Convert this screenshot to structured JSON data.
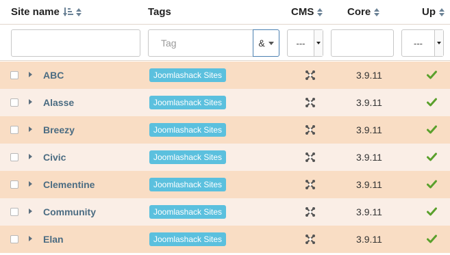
{
  "header": {
    "site_name": "Site name",
    "tags": "Tags",
    "cms": "CMS",
    "core": "Core",
    "up": "Up"
  },
  "filters": {
    "site_name_value": "",
    "tag_placeholder": "Tag",
    "tag_mode": "&",
    "cms_select": "---",
    "core_value": "",
    "up_select": "---"
  },
  "rows": [
    {
      "name": "ABC",
      "tag": "Joomlashack Sites",
      "cms_icon": "joomla-icon",
      "core": "3.9.11",
      "up_icon": "check-icon"
    },
    {
      "name": "Alasse",
      "tag": "Joomlashack Sites",
      "cms_icon": "joomla-icon",
      "core": "3.9.11",
      "up_icon": "check-icon"
    },
    {
      "name": "Breezy",
      "tag": "Joomlashack Sites",
      "cms_icon": "joomla-icon",
      "core": "3.9.11",
      "up_icon": "check-icon"
    },
    {
      "name": "Civic",
      "tag": "Joomlashack Sites",
      "cms_icon": "joomla-icon",
      "core": "3.9.11",
      "up_icon": "check-icon"
    },
    {
      "name": "Clementine",
      "tag": "Joomlashack Sites",
      "cms_icon": "joomla-icon",
      "core": "3.9.11",
      "up_icon": "check-icon"
    },
    {
      "name": "Community",
      "tag": "Joomlashack Sites",
      "cms_icon": "joomla-icon",
      "core": "3.9.11",
      "up_icon": "check-icon"
    },
    {
      "name": "Elan",
      "tag": "Joomlashack Sites",
      "cms_icon": "joomla-icon",
      "core": "3.9.11",
      "up_icon": "check-icon"
    }
  ],
  "colors": {
    "row_odd": "#f9ddc4",
    "row_even": "#faeee6",
    "tag_bg": "#5bc0de",
    "link": "#4b6c82",
    "check": "#5aa02c"
  }
}
